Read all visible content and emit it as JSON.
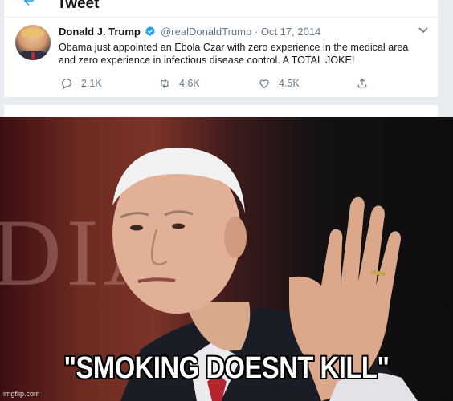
{
  "tweet_header": {
    "title": "Tweet"
  },
  "tweet": {
    "author_name": "Donald J. Trump",
    "handle": "@realDonaldTrump",
    "separator": "·",
    "date": "Oct 17, 2014",
    "text": "Obama just appointed an Ebola Czar with zero experience in the medical area and zero experience in infectious disease control. A TOTAL JOKE!",
    "replies": "2.1K",
    "retweets": "4.6K",
    "likes": "4.5K",
    "verified_icon": "verified-badge-icon",
    "accent_color": "#1da1f2"
  },
  "meme": {
    "caption": "\"SMOKING DOESNT KILL\"",
    "watermark": "imgflip.com"
  }
}
